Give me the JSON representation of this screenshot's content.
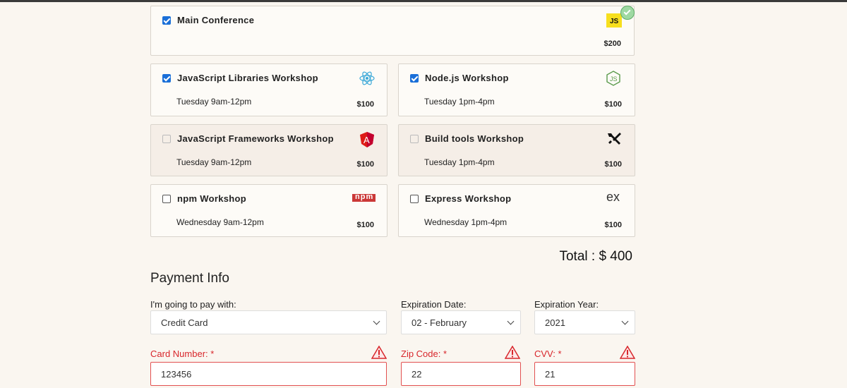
{
  "workshops": [
    {
      "title": "Main Conference",
      "time": "",
      "price": "$200",
      "checked": true,
      "disabled": false,
      "icon": "js-logo-icon",
      "icon_text": "JS"
    },
    {
      "title": "JavaScript Libraries Workshop",
      "time": "Tuesday 9am-12pm",
      "price": "$100",
      "checked": true,
      "disabled": false,
      "icon": "react-logo-icon"
    },
    {
      "title": "Node.js Workshop",
      "time": "Tuesday 1pm-4pm",
      "price": "$100",
      "checked": true,
      "disabled": false,
      "icon": "nodejs-logo-icon",
      "icon_text": "JS"
    },
    {
      "title": "JavaScript Frameworks Workshop",
      "time": "Tuesday 9am-12pm",
      "price": "$100",
      "checked": false,
      "disabled": true,
      "icon": "angular-logo-icon",
      "icon_text": "A"
    },
    {
      "title": "Build tools Workshop",
      "time": "Tuesday 1pm-4pm",
      "price": "$100",
      "checked": false,
      "disabled": true,
      "icon": "tools-icon"
    },
    {
      "title": "npm Workshop",
      "time": "Wednesday 9am-12pm",
      "price": "$100",
      "checked": false,
      "disabled": false,
      "icon": "npm-logo-icon",
      "icon_text": "npm"
    },
    {
      "title": "Express Workshop",
      "time": "Wednesday 1pm-4pm",
      "price": "$100",
      "checked": false,
      "disabled": false,
      "icon": "express-logo-icon",
      "icon_text": "ex"
    }
  ],
  "total_label": "Total : $ 400",
  "payment": {
    "section_title": "Payment Info",
    "method_label": "I'm going to pay with:",
    "method_value": "Credit Card",
    "exp_date_label": "Expiration Date:",
    "exp_date_value": "02 - February",
    "exp_year_label": "Expiration Year:",
    "exp_year_value": "2021",
    "card_label": "Card Number: *",
    "card_value": "123456",
    "zip_label": "Zip Code: *",
    "zip_value": "22",
    "cvv_label": "CVV: *",
    "cvv_value": "21"
  },
  "colors": {
    "error": "#d8262b",
    "checkbox": "#1a6fd8",
    "background": "#faf6f0",
    "success": "#7fcf86"
  }
}
